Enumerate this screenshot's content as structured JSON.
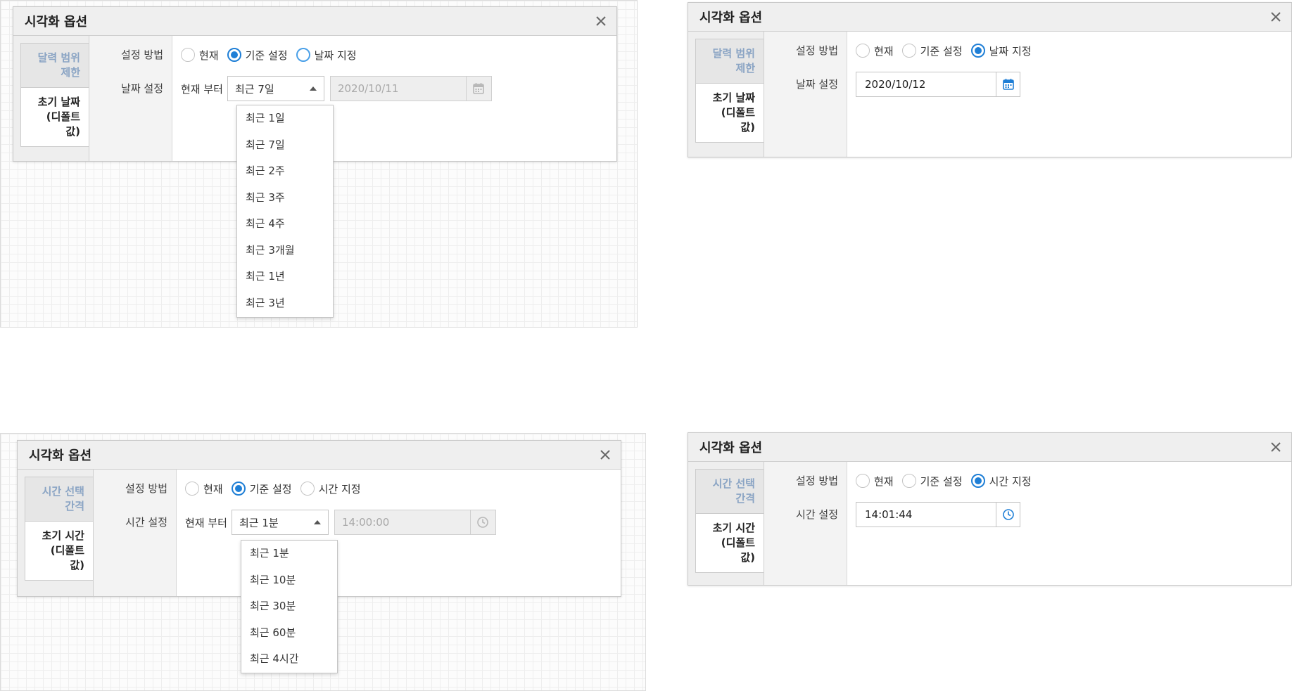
{
  "panel1": {
    "title": "시각화 옵션",
    "side_tabs": [
      "달력 범위\n제한",
      "초기 날짜\n(디폴트\n값)"
    ],
    "labels": [
      "설정 방법",
      "날짜 설정"
    ],
    "radios": [
      "현재",
      "기준 설정",
      "날짜 지정"
    ],
    "from_label": "현재 부터",
    "select_value": "최근 7일",
    "input_value": "2020/10/11",
    "options": [
      "최근 1일",
      "최근 7일",
      "최근 2주",
      "최근 3주",
      "최근 4주",
      "최근 3개월",
      "최근 1년",
      "최근 3년"
    ]
  },
  "panel2": {
    "title": "시각화 옵션",
    "side_tabs": [
      "달력 범위\n제한",
      "초기 날짜\n(디폴트\n값)"
    ],
    "labels": [
      "설정 방법",
      "날짜 설정"
    ],
    "radios": [
      "현재",
      "기준 설정",
      "날짜 지정"
    ],
    "input_value": "2020/10/12"
  },
  "panel3": {
    "title": "시각화 옵션",
    "side_tabs": [
      "시간 선택\n간격",
      "초기 시간\n(디폴트\n값)"
    ],
    "labels": [
      "설정 방법",
      "시간 설정"
    ],
    "radios": [
      "현재",
      "기준 설정",
      "시간 지정"
    ],
    "from_label": "현재 부터",
    "select_value": "최근 1분",
    "input_value": "14:00:00",
    "options": [
      "최근 1분",
      "최근 10분",
      "최근 30분",
      "최근 60분",
      "최근 4시간"
    ]
  },
  "panel4": {
    "title": "시각화 옵션",
    "side_tabs": [
      "시간 선택\n간격",
      "초기 시간\n(디폴트\n값)"
    ],
    "labels": [
      "설정 방법",
      "시간 설정"
    ],
    "radios": [
      "현재",
      "기준 설정",
      "시간 지정"
    ],
    "input_value": "14:01:44"
  },
  "colors": {
    "accent": "#1f7fd6",
    "inactive_tab_text": "#8aa4c4"
  },
  "icons": {
    "close": "close-icon",
    "calendar": "calendar-icon",
    "clock": "clock-icon",
    "dropdown": "chevron-up-icon"
  }
}
